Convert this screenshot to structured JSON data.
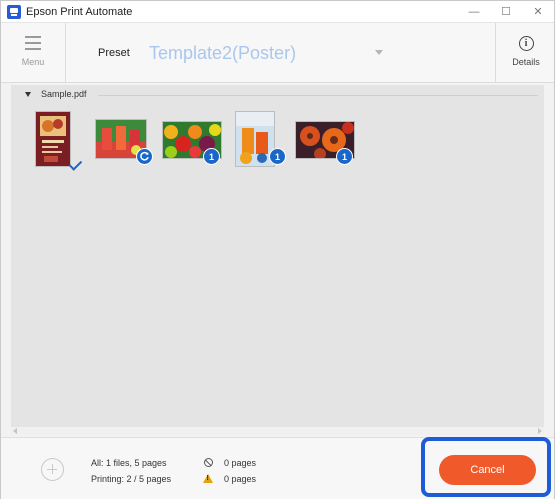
{
  "window": {
    "title": "Epson Print Automate",
    "controls": [
      "—",
      "☐",
      "✕"
    ]
  },
  "toolbar": {
    "menu_label": "Menu",
    "preset_label": "Preset",
    "preset_value": "Template2(Poster)",
    "details_label": "Details",
    "details_glyph": "i"
  },
  "file_group": {
    "name": "Sample.pdf",
    "pages": [
      {
        "thumb": "poster-page",
        "status": "done-check"
      },
      {
        "thumb": "drinks-photo",
        "status": "processing",
        "badge": ""
      },
      {
        "thumb": "fruit-photo",
        "status": "count",
        "badge": "1"
      },
      {
        "thumb": "juice-photo",
        "status": "count",
        "badge": "1"
      },
      {
        "thumb": "flower-photo",
        "status": "count",
        "badge": "1"
      }
    ]
  },
  "footer": {
    "all_text": "All: 1 files, 5 pages",
    "printing_text": "Printing: 2 / 5 pages",
    "skipped_text": "0 pages",
    "warning_text": "0 pages",
    "cancel_label": "Cancel"
  },
  "colors": {
    "accent": "#1a66c9",
    "cancel": "#f05a2a",
    "highlight": "#1e5bd6",
    "preset_text": "#a9c7ee"
  }
}
